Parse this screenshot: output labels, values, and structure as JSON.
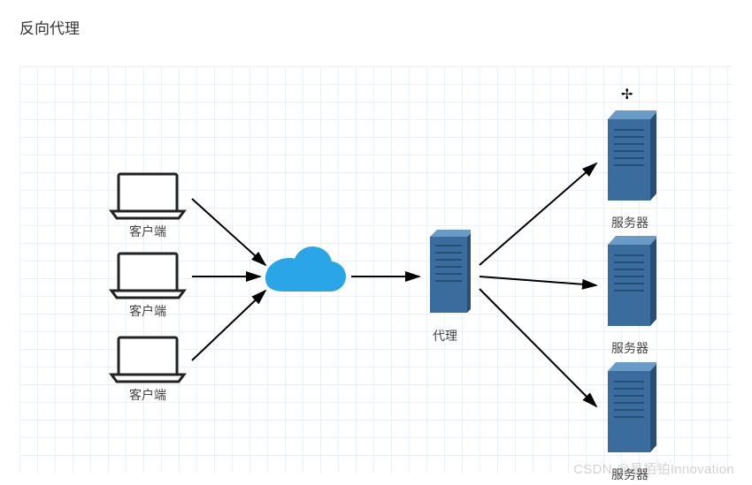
{
  "title": "反向代理",
  "clients": [
    {
      "label": "客户端"
    },
    {
      "label": "客户端"
    },
    {
      "label": "客户端"
    }
  ],
  "proxy": {
    "label": "代理"
  },
  "servers": [
    {
      "label": "服务器"
    },
    {
      "label": "服务器"
    },
    {
      "label": "服务器"
    }
  ],
  "watermark": "CSDN @易栢铂Innovation",
  "colors": {
    "cloud": "#2aa6e8",
    "serverDark": "#2c5a8e",
    "serverLight": "#4a78a8",
    "laptopStroke": "#222222",
    "arrow": "#000000",
    "grid": "#e9f0f6"
  },
  "chart_data": {
    "type": "diagram",
    "title": "反向代理",
    "nodes": [
      {
        "id": "client1",
        "type": "client",
        "label": "客户端"
      },
      {
        "id": "client2",
        "type": "client",
        "label": "客户端"
      },
      {
        "id": "client3",
        "type": "client",
        "label": "客户端"
      },
      {
        "id": "cloud",
        "type": "cloud",
        "label": ""
      },
      {
        "id": "proxy",
        "type": "proxy-server",
        "label": "代理"
      },
      {
        "id": "server1",
        "type": "server",
        "label": "服务器"
      },
      {
        "id": "server2",
        "type": "server",
        "label": "服务器"
      },
      {
        "id": "server3",
        "type": "server",
        "label": "服务器"
      }
    ],
    "edges": [
      {
        "from": "client1",
        "to": "cloud"
      },
      {
        "from": "client2",
        "to": "cloud"
      },
      {
        "from": "client3",
        "to": "cloud"
      },
      {
        "from": "cloud",
        "to": "proxy"
      },
      {
        "from": "proxy",
        "to": "server1"
      },
      {
        "from": "proxy",
        "to": "server2"
      },
      {
        "from": "proxy",
        "to": "server3"
      }
    ],
    "description": "Reverse proxy topology: three clients connect through a cloud to a single proxy, which fans out to three backend servers."
  }
}
